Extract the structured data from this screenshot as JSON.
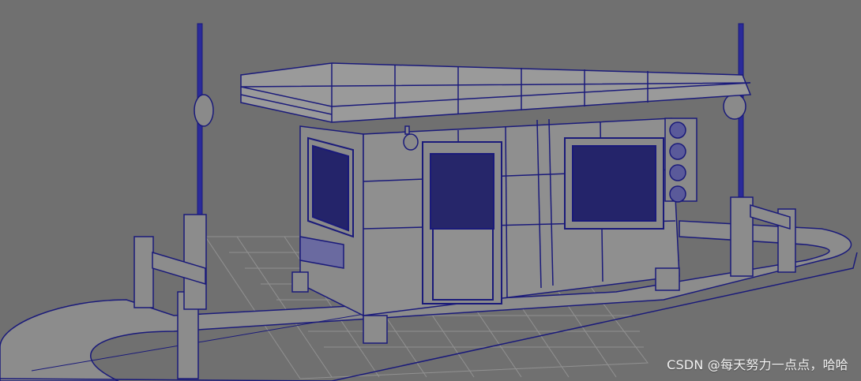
{
  "viewport": {
    "watermark": "CSDN @每天努力一点点，哈哈"
  },
  "colors": {
    "background": "#707070",
    "wire": "#1a1a7a",
    "surface": "#8a8a8a",
    "grid": "#9a9a9a"
  },
  "icons": {
    "camera": "camera-icon",
    "traffic_light": "traffic-light-icon"
  }
}
